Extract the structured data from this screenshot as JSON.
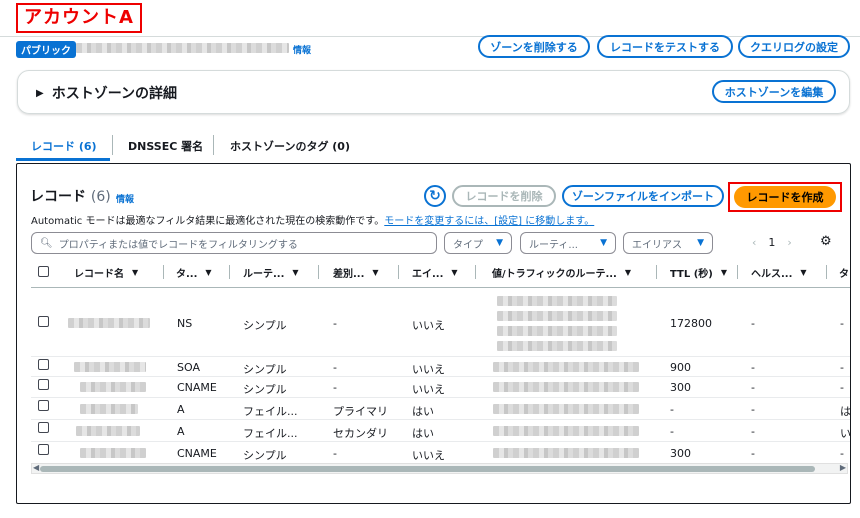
{
  "account_label": "アカウントA",
  "header": {
    "badge": "パブリック",
    "info": "情報",
    "buttons": {
      "delete_zone": "ゾーンを削除する",
      "test_record": "レコードをテストする",
      "query_log": "クエリログの設定"
    }
  },
  "details_panel": {
    "title": "ホストゾーンの詳細",
    "edit_button": "ホストゾーンを編集"
  },
  "tabs": [
    {
      "label": "レコード (6)"
    },
    {
      "label": "DNSSEC 署名"
    },
    {
      "label": "ホストゾーンのタグ (0)"
    }
  ],
  "records": {
    "title": "レコード",
    "count": "(6)",
    "info": "情報",
    "delete_button": "レコードを削除",
    "import_button": "ゾーンファイルをインポート",
    "create_button": "レコードを作成",
    "auto_text": "Automatic モードは最適なフィルタ結果に最適化された現在の検索動作です。",
    "auto_link": "モードを変更するには、[設定] に移動します。",
    "search_placeholder": "プロパティまたは値でレコードをフィルタリングする",
    "filters": {
      "type": "タイプ",
      "routing": "ルーティ...",
      "alias": "エイリアス"
    },
    "pager": {
      "prev": "‹",
      "page": "1",
      "next": "›"
    },
    "columns": [
      "レコード名",
      "タ...",
      "ルーテ...",
      "差別...",
      "エイ...",
      "値/トラフィックのルーテ...",
      "TTL (秒)",
      "ヘルス...",
      "タ"
    ],
    "rows": [
      {
        "type": "NS",
        "routing": "シンプル",
        "diff": "-",
        "alias": "いいえ",
        "ttl": "172800",
        "health": "-",
        "last": "-"
      },
      {
        "type": "SOA",
        "routing": "シンプル",
        "diff": "-",
        "alias": "いいえ",
        "ttl": "900",
        "health": "-",
        "last": "-"
      },
      {
        "type": "CNAME",
        "routing": "シンプル",
        "diff": "-",
        "alias": "いいえ",
        "ttl": "300",
        "health": "-",
        "last": "-"
      },
      {
        "type": "A",
        "routing": "フェイル...",
        "diff": "プライマリ",
        "alias": "はい",
        "ttl": "-",
        "health": "-",
        "last": "は"
      },
      {
        "type": "A",
        "routing": "フェイル...",
        "diff": "セカンダリ",
        "alias": "はい",
        "ttl": "-",
        "health": "-",
        "last": "い"
      },
      {
        "type": "CNAME",
        "routing": "シンプル",
        "diff": "-",
        "alias": "いいえ",
        "ttl": "300",
        "health": "-",
        "last": "-"
      }
    ]
  },
  "colors": {
    "accent": "#0972d3",
    "create": "#ff9900",
    "highlight": "#ee0000"
  },
  "icons": {
    "refresh": "refresh-icon",
    "search": "search-icon",
    "settings": "gear-icon",
    "expand": "caret-right-icon"
  }
}
